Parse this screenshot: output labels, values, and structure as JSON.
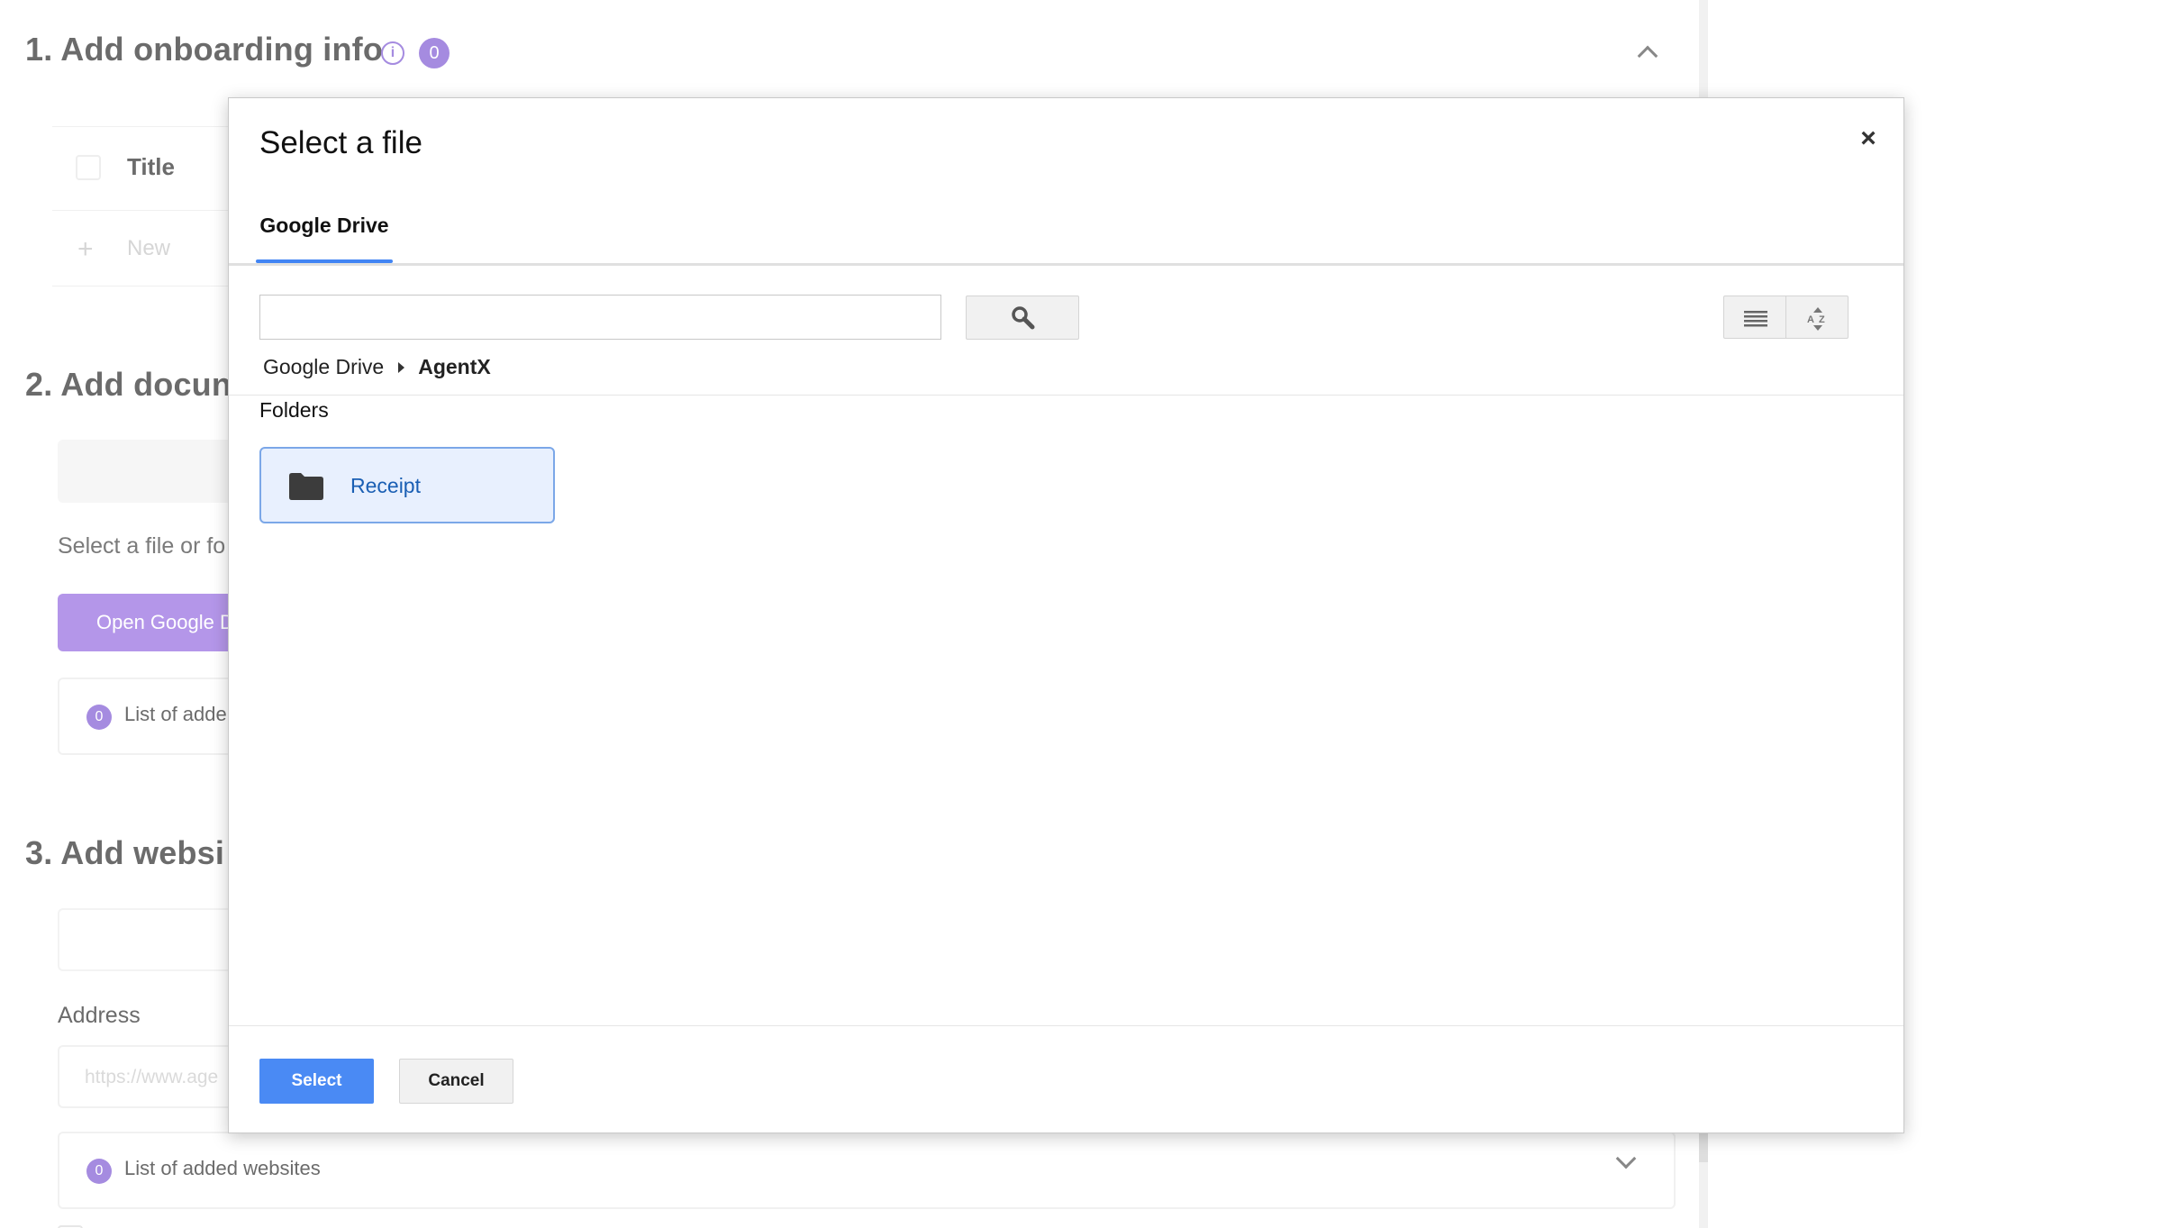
{
  "background": {
    "section1": {
      "title": "1. Add onboarding info",
      "badge_count": "0"
    },
    "table": {
      "title_header": "Title",
      "new_row_label": "New"
    },
    "section2": {
      "title": "2. Add docun",
      "helper_text": "Select a file or fo",
      "open_drive_label": "Open Google D",
      "list_count": "0",
      "list_label": "List of adde"
    },
    "section3": {
      "title": "3. Add websi",
      "address_label": "Address",
      "address_placeholder": "https://www.age",
      "list_count": "0",
      "list_label": "List of added websites"
    }
  },
  "modal": {
    "title": "Select a file",
    "close_symbol": "×",
    "tab_label": "Google Drive",
    "search": {
      "value": "",
      "placeholder": ""
    },
    "breadcrumb": {
      "root": "Google Drive",
      "current": "AgentX"
    },
    "folders_label": "Folders",
    "folders": [
      {
        "name": "Receipt"
      }
    ],
    "select_label": "Select",
    "cancel_label": "Cancel"
  },
  "colors": {
    "accent_purple": "#a58be0",
    "button_purple": "#b496e9",
    "primary_blue": "#4a8af4",
    "selected_folder_bg": "#e8f0fe",
    "tab_underline": "#4285f4"
  },
  "icons": [
    "info-icon",
    "chevron-up-icon",
    "plus-icon",
    "search-icon",
    "list-view-icon",
    "sort-az-icon",
    "folder-icon",
    "close-icon",
    "chevron-down-icon"
  ]
}
